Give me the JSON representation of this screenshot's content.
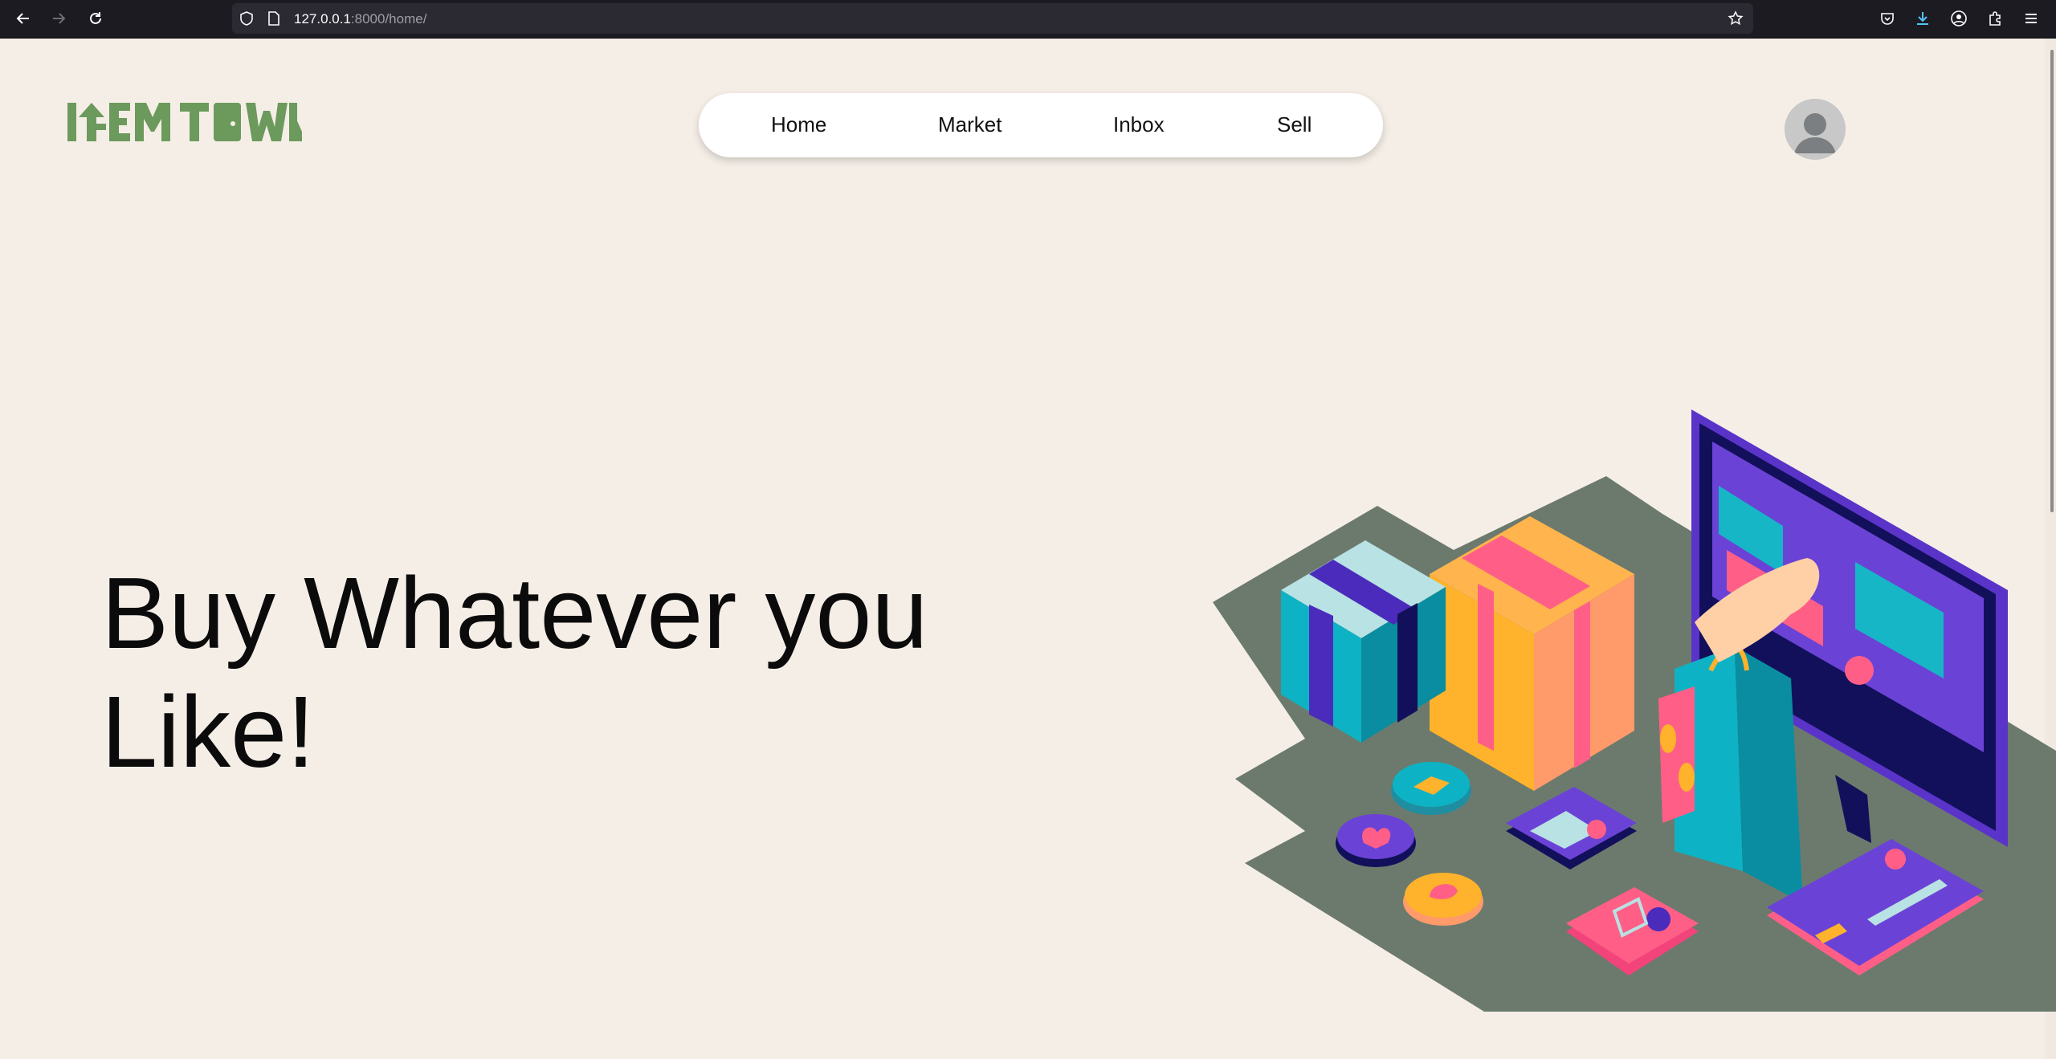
{
  "browser": {
    "url_host": "127.0.0.1",
    "url_path": ":8000/home/"
  },
  "site": {
    "logo_text": "ITEM TOWN"
  },
  "nav": {
    "items": [
      {
        "label": "Home"
      },
      {
        "label": "Market"
      },
      {
        "label": "Inbox"
      },
      {
        "label": "Sell"
      }
    ]
  },
  "hero": {
    "line1": "Buy Whatever you",
    "line2": "Like!"
  },
  "colors": {
    "background": "#f5eee7",
    "logo_green": "#6c9a5c",
    "nav_bg": "#ffffff",
    "illustration_floor": "#6c7a6e"
  }
}
